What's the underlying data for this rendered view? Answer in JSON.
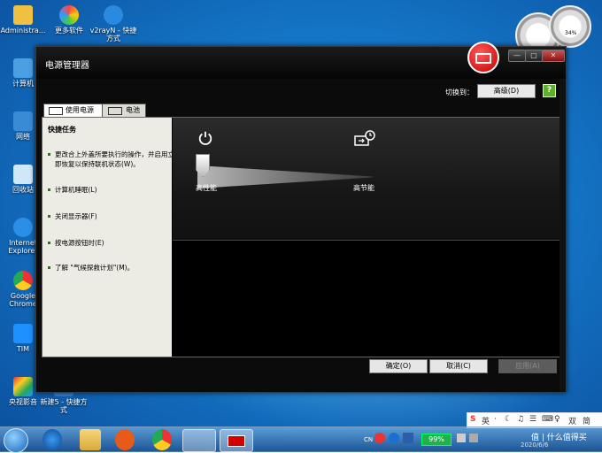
{
  "desktop": {
    "icons": [
      {
        "label": "Administra...",
        "name": "administrator-folder"
      },
      {
        "label": "更多软件",
        "name": "more-software"
      },
      {
        "label": "v2rayN - 快捷方式",
        "name": "v2rayn-shortcut"
      },
      {
        "label": "计算机",
        "name": "computer"
      },
      {
        "label": "网络",
        "name": "network"
      },
      {
        "label": "回收站",
        "name": "recycle-bin"
      },
      {
        "label": "Internet Explorer",
        "name": "internet-explorer"
      },
      {
        "label": "Google Chrome",
        "name": "google-chrome"
      },
      {
        "label": "TIM",
        "name": "tim"
      },
      {
        "label": "央视影音",
        "name": "cctv-video"
      },
      {
        "label": "新建5 - 快捷方式",
        "name": "new5-shortcut"
      }
    ],
    "gadget_percent": "34%"
  },
  "window": {
    "title": "电源管理器",
    "controls": {
      "minimize": "—",
      "maximize": "▢",
      "close": "✕"
    },
    "switch_label": "切换到：",
    "switch_button": "高级(D)",
    "help": "?",
    "tabs": [
      "使用电源",
      "电池"
    ],
    "quick_tasks": {
      "title": "快捷任务",
      "items": [
        "更改合上外盖所要执行的操作，并启用立即恢复以保持联机状态(W)。",
        "计算机睡眠(L)",
        "关闭显示器(F)",
        "按电源按钮时(E)",
        "了解 \"气候探救计划\"(M)。"
      ]
    },
    "slider": {
      "left_label": "高性能",
      "right_label": "高节能",
      "value_percent": 0
    },
    "buttons": {
      "ok": "确定(O)",
      "cancel": "取消(C)",
      "apply": "应用(A)"
    }
  },
  "tray": {
    "ime_label": "英",
    "ime_items": [
      "S",
      "英",
      "·",
      "☾",
      "♫",
      "☰",
      "⌨",
      "♀",
      "双",
      "简"
    ],
    "lang": "CN",
    "battery_percent": "99%",
    "date": "2020/6/6",
    "watermark": "值 | 什么值得买"
  },
  "colors": {
    "window_bg": "#0b0b0b",
    "left_panel": "#ecebe4",
    "battery_green": "#1fb24a",
    "badge_red": "#d40000"
  }
}
